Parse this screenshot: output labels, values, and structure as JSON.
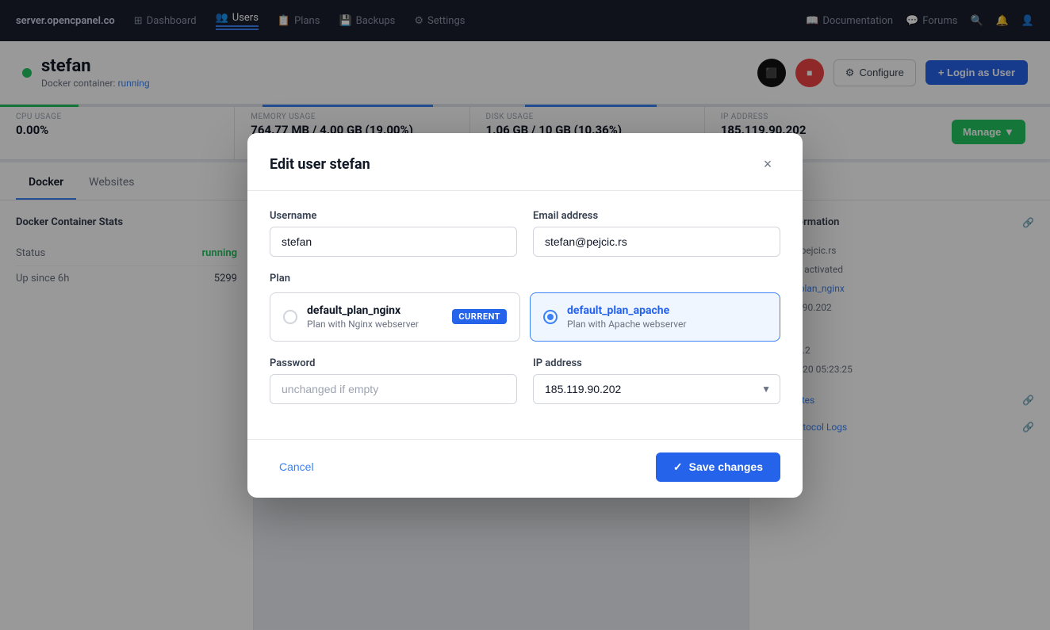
{
  "navbar": {
    "brand": "server.opencpanel.co",
    "items": [
      {
        "label": "Dashboard",
        "active": false
      },
      {
        "label": "Users",
        "active": true
      },
      {
        "label": "Plans",
        "active": false
      },
      {
        "label": "Backups",
        "active": false
      },
      {
        "label": "Settings",
        "active": false
      }
    ],
    "right_items": [
      {
        "label": "Documentation"
      },
      {
        "label": "Forums"
      }
    ]
  },
  "server": {
    "name": "stefan",
    "status": "running",
    "status_label": "Docker container: running"
  },
  "stats": [
    {
      "label": "CPU USAGE",
      "value": "0.00%"
    },
    {
      "label": "MEMORY USAGE",
      "value": "764.77 MB / 4.00 GB (19.00%)"
    },
    {
      "label": "DISK USAGE",
      "value": "1.06 GB / 10 GB (10.36%)"
    },
    {
      "label": "IP ADDRESS",
      "value": "185.119.90.202"
    }
  ],
  "tabs": [
    {
      "label": "Docker",
      "active": true
    },
    {
      "label": "Websites",
      "active": false
    }
  ],
  "modal": {
    "title": "Edit user stefan",
    "close_label": "×",
    "fields": {
      "username_label": "Username",
      "username_value": "stefan",
      "email_label": "Email address",
      "email_value": "stefan@pejcic.rs",
      "plan_label": "Plan",
      "plan_options": [
        {
          "name": "default_plan_nginx",
          "desc": "Plan with Nginx webserver",
          "badge": "CURRENT",
          "selected": false
        },
        {
          "name": "default_plan_apache",
          "desc": "Plan with Apache webserver",
          "badge": "",
          "selected": true
        }
      ],
      "password_label": "Password",
      "password_placeholder": "unchanged if empty",
      "ip_label": "IP address",
      "ip_value": "185.119.90.202",
      "ip_options": [
        "185.119.90.202"
      ]
    },
    "cancel_label": "Cancel",
    "save_label": "Save changes"
  },
  "colors": {
    "primary": "#2563eb",
    "success": "#22c55e",
    "danger": "#ef4444"
  }
}
